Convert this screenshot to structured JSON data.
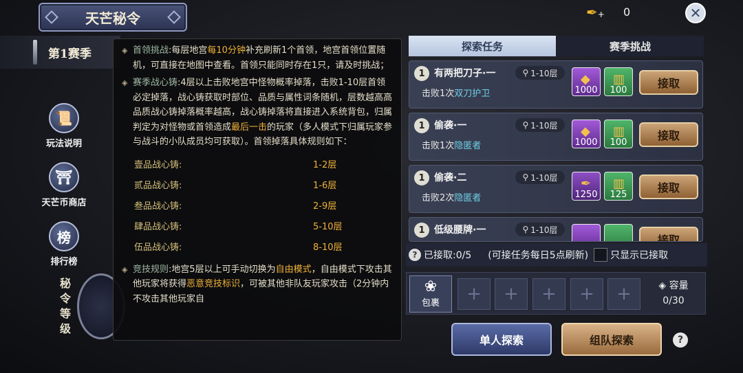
{
  "header": {
    "title": "天芒秘令",
    "season": "第1赛季"
  },
  "currency": {
    "icon": "feather-plus-icon",
    "value": "0"
  },
  "side_menu": [
    {
      "label": "玩法说明",
      "icon": "scroll-icon"
    },
    {
      "label": "天芒币商店",
      "icon": "shop-icon"
    },
    {
      "label": "排行榜",
      "icon": "rank-banner-icon"
    }
  ],
  "rank_label": [
    "秘",
    "令",
    "等",
    "级"
  ],
  "tooltip": {
    "boss": {
      "title": "首领挑战",
      "pre": ":每层地宫",
      "hl": "每10分钟",
      "post": "补充刷新1个首领，地宫首领位置随机，可直接在地图中查看。首领只能同时存在1只，请及时挑战；"
    },
    "heart": {
      "title": "赛季战心铸",
      "pre": ":4层以上击败地宫中怪物概率掉落，击败1-10层首领必定掉落，战心铸获取时部位、品质与属性词条随机，层数越高高品质战心铸掉落概率越高，战心铸掉落将直接进入系统背包，归属判定为对怪物或首领造成",
      "hl": "最后一击",
      "post": "的玩家（多人模式下归属玩家参与战斗的小队成员均可获取）。首领掉落具体规则如下："
    },
    "tiers": [
      {
        "name": "壹品战心铸:",
        "floors": "1-2层"
      },
      {
        "name": "贰品战心铸:",
        "floors": "1-6层"
      },
      {
        "name": "叁品战心铸:",
        "floors": "2-9层"
      },
      {
        "name": "肆品战心铸:",
        "floors": "5-10层"
      },
      {
        "name": "伍品战心铸:",
        "floors": "8-10层"
      }
    ],
    "pvp": {
      "title": "竞技规则",
      "pre": ":地宫5层以上可手动切换为",
      "hl1": "自由模式",
      "mid": "，自由模式下攻击其他玩家将获得",
      "hl2": "恶意竞技标识",
      "post": "，可被其他非队友玩家攻击（2分钟内不攻击其他玩家自"
    }
  },
  "tabs": {
    "explore": "探索任务",
    "season": "赛季挑战"
  },
  "tasks": [
    {
      "badge": "1",
      "name": "有两把刀子·一",
      "floor": "1-10层",
      "desc_pre": "击败1次",
      "target": "双刀护卫",
      "reward1": "1000",
      "reward2": "100",
      "action": "接取"
    },
    {
      "badge": "1",
      "name": "偷袭·一",
      "floor": "1-10层",
      "desc_pre": "击败1次",
      "target": "隐匿者",
      "reward1": "1000",
      "reward2": "100",
      "action": "接取"
    },
    {
      "badge": "1",
      "name": "偷袭·二",
      "floor": "1-10层",
      "desc_pre": "击败2次",
      "target": "隐匿者",
      "reward1": "1250",
      "reward2": "125",
      "action": "接取"
    },
    {
      "badge": "1",
      "name": "低级腰牌·一",
      "floor": "1-10层",
      "desc_pre": "",
      "target": "",
      "reward1": "",
      "reward2": "",
      "action": "接取"
    }
  ],
  "info": {
    "accepted": "已接取:0/5",
    "note": "(可接任务每日5点刷新)",
    "only_accepted": "只显示已接取"
  },
  "bag": {
    "label": "包裹",
    "capacity_label": "容量",
    "capacity": "0/30"
  },
  "buttons": {
    "solo": "单人探索",
    "team": "组队探索"
  }
}
